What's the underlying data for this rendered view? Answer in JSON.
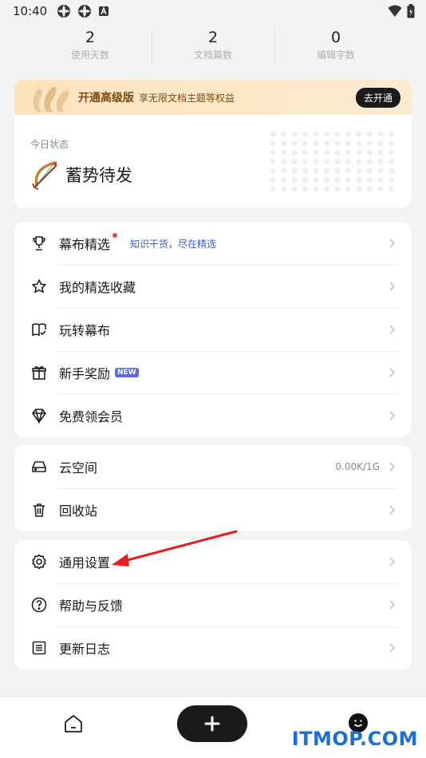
{
  "status_bar": {
    "time": "10:40"
  },
  "stats": [
    {
      "value": "2",
      "label": "使用天数"
    },
    {
      "value": "2",
      "label": "文档篇数"
    },
    {
      "value": "0",
      "label": "编辑字数"
    }
  ],
  "promo": {
    "title": "开通高级版",
    "subtitle": "享无限文档主题等权益",
    "button": "去开通"
  },
  "today": {
    "label": "今日状态",
    "status": "蓄势待发",
    "icon": "bow-arrow-icon"
  },
  "menu_group_1": [
    {
      "icon": "trophy-icon",
      "label": "幕布精选",
      "hint": "知识干货，尽在精选",
      "dot": true
    },
    {
      "icon": "star-icon",
      "label": "我的精选收藏"
    },
    {
      "icon": "book-icon",
      "label": "玩转幕布"
    },
    {
      "icon": "gift-icon",
      "label": "新手奖励",
      "badge": "NEW"
    },
    {
      "icon": "diamond-icon",
      "label": "免费领会员"
    }
  ],
  "menu_group_2": [
    {
      "icon": "drive-icon",
      "label": "云空间",
      "value": "0.00K/1G"
    },
    {
      "icon": "trash-icon",
      "label": "回收站"
    }
  ],
  "menu_group_3": [
    {
      "icon": "gear-icon",
      "label": "通用设置"
    },
    {
      "icon": "help-icon",
      "label": "帮助与反馈"
    },
    {
      "icon": "list-icon",
      "label": "更新日志"
    }
  ],
  "watermark": "ITMOP.COM",
  "colors": {
    "accent_blue": "#3b5bdb",
    "badge": "#5b6be0",
    "promo_bg": "#fbe3bd",
    "annotation": "#e02020"
  }
}
